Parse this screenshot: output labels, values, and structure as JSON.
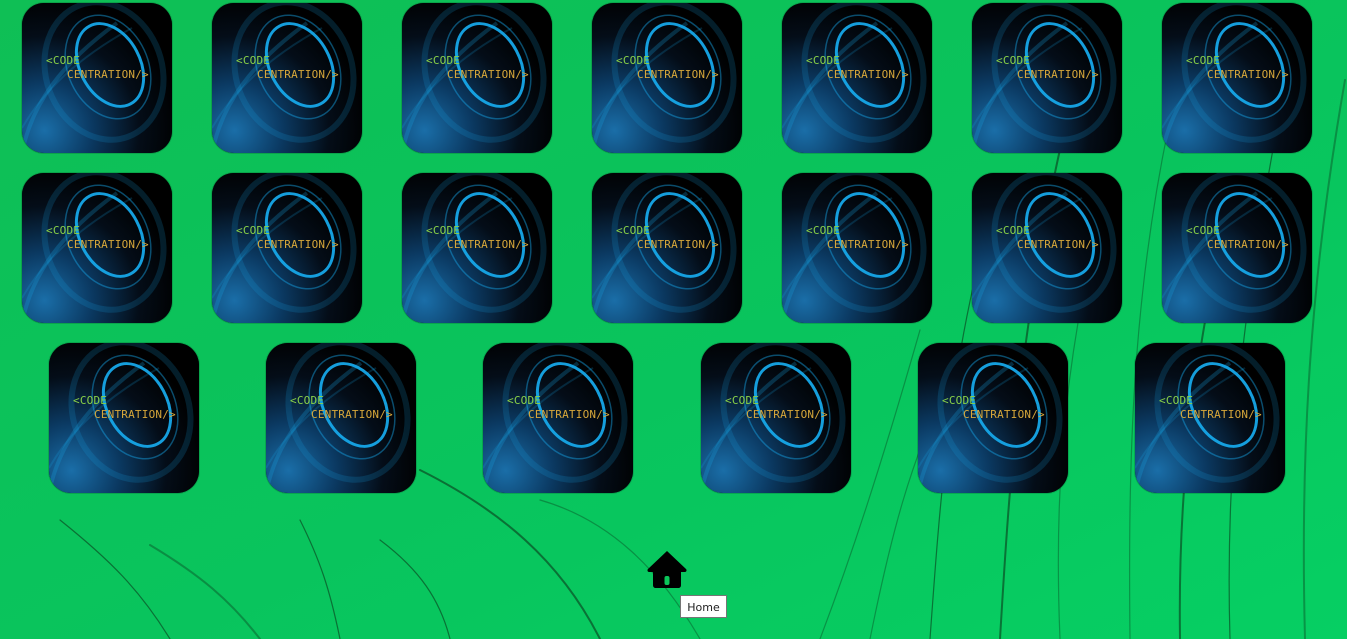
{
  "page": {
    "background_color": "#0bc55a",
    "stroke_color": "#0b2b14"
  },
  "game": {
    "card_back": {
      "line1": "<CODE",
      "line2": "CENTRATION/>",
      "line1_color": "#8ad148",
      "line2_color": "#d7a73a",
      "ring_color": "#16a7e8",
      "background_color": "#000000"
    },
    "rows": [
      {
        "count": 7
      },
      {
        "count": 7
      },
      {
        "count": 6
      }
    ]
  },
  "home": {
    "icon": "home-icon",
    "tooltip": "Home"
  }
}
